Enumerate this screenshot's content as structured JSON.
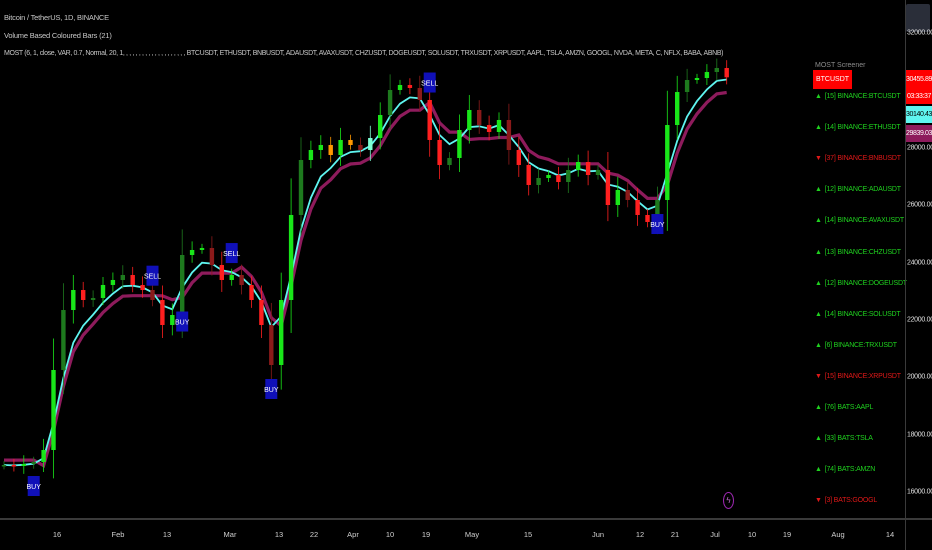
{
  "header": {
    "symbol_line": "Bitcoin / TetherUS, 1D, BINANCE",
    "indicator_1": "Volume Based Coloured Bars (21)",
    "indicator_2": "MOST (6, 1, close, VAR, 0.7, Normal, 20, 1, , , , , , , , , , , , , , , , , , , , BTCUSDT, ETHUSDT, BNBUSDT, ADAUSDT, AVAXUSDT, CHZUSDT, DOGEUSDT, SOLUSDT, TRXUSDT, XRPUSDT, AAPL, TSLA, AMZN, GOOGL, NVDA, META, C, NFLX, BABA, ABNB)"
  },
  "screener": {
    "title": "MOST Screener",
    "symbol_badge": "BTCUSDT",
    "rows": [
      {
        "dir": "up",
        "text": "[15] BINANCE:BTCUSDT"
      },
      {
        "dir": "up",
        "text": "[14] BINANCE:ETHUSDT"
      },
      {
        "dir": "down",
        "text": "[37] BINANCE:BNBUSDT"
      },
      {
        "dir": "up",
        "text": "[12] BINANCE:ADAUSDT"
      },
      {
        "dir": "up",
        "text": "[14] BINANCE:AVAXUSDT"
      },
      {
        "dir": "up",
        "text": "[13] BINANCE:CHZUSDT"
      },
      {
        "dir": "up",
        "text": "[12] BINANCE:DOGEUSDT"
      },
      {
        "dir": "up",
        "text": "[14] BINANCE:SOLUSDT"
      },
      {
        "dir": "up",
        "text": "[6] BINANCE:TRXUSDT"
      },
      {
        "dir": "down",
        "text": "[15] BINANCE:XRPUSDT"
      },
      {
        "dir": "up",
        "text": "[76] BATS:AAPL"
      },
      {
        "dir": "up",
        "text": "[33] BATS:TSLA"
      },
      {
        "dir": "up",
        "text": "[74] BATS:AMZN"
      },
      {
        "dir": "down",
        "text": "[3] BATS:GOOGL"
      }
    ],
    "up_arrow": "▲",
    "down_arrow": "▼"
  },
  "price_labels": {
    "last_price": "30455.89",
    "countdown": "03:33:37",
    "most_ema": "30140.43",
    "most_stop": "29839.03"
  },
  "colors": {
    "background": "#000000",
    "up_strong": "#19e619",
    "up_weak": "#1e7a1e",
    "down_strong": "#ff1f1f",
    "down_weak": "#8b1a1a",
    "orange": "#ff9800",
    "aqua": "#7fffd4",
    "most_ema": "#5ff5f0",
    "most_stop": "#8e1b5c",
    "signal_box": "#1010b8",
    "screener_up": "#1fd21f",
    "screener_down": "#e01818",
    "last_price_bg": "#ff0000"
  },
  "chart_data": {
    "type": "candlestick",
    "title": "Bitcoin / TetherUS, 1D, BINANCE",
    "closes": [
      16948,
      16913,
      16983,
      17052,
      17470,
      20258,
      22348,
      23045,
      22697,
      22767,
      23220,
      23394,
      23568,
      23220,
      23045,
      22697,
      21826,
      22174,
      24265,
      24439,
      24509,
      23916,
      23394,
      23568,
      23220,
      22697,
      21826,
      20432,
      22697,
      25659,
      27575,
      27923,
      28098,
      27749,
      28272,
      28098,
      27923,
      28341,
      29143,
      30014,
      30188,
      30084,
      29666,
      28272,
      27401,
      27645,
      28620,
      29317,
      28794,
      28551,
      28969,
      27923,
      27401,
      26704,
      26948,
      27052,
      26808,
      27226,
      27505,
      27052,
      27226,
      26007,
      26530,
      26181,
      25659,
      25415,
      26181,
      28794,
      29944,
      30362,
      30432,
      30641,
      30780,
      30456
    ],
    "signals": [
      {
        "label": "BUY",
        "index": 3
      },
      {
        "label": "SELL",
        "index": 15
      },
      {
        "label": "BUY",
        "index": 18
      },
      {
        "label": "SELL",
        "index": 23
      },
      {
        "label": "BUY",
        "index": 27
      },
      {
        "label": "SELL",
        "index": 43
      },
      {
        "label": "BUY",
        "index": 66
      }
    ],
    "y_ticks": [
      "32000.00",
      "30000.00",
      "28000.00",
      "26000.00",
      "24000.00",
      "22000.00",
      "20000.00",
      "18000.00",
      "16000.00"
    ],
    "y_tick_values": [
      32000,
      30000,
      28000,
      26000,
      24000,
      22000,
      20000,
      18000,
      16000
    ],
    "x_ticks": [
      "16",
      "Feb",
      "13",
      "Mar",
      "13",
      "22",
      "Apr",
      "10",
      "19",
      "May",
      "15",
      "Jun",
      "12",
      "21",
      "Jul",
      "10",
      "19",
      "Aug",
      "14"
    ],
    "ylim": [
      15500,
      33000
    ],
    "grid": false,
    "series": [
      {
        "name": "MOST",
        "role": "moving average"
      },
      {
        "name": "MOST",
        "role": "trailing stop"
      }
    ]
  }
}
